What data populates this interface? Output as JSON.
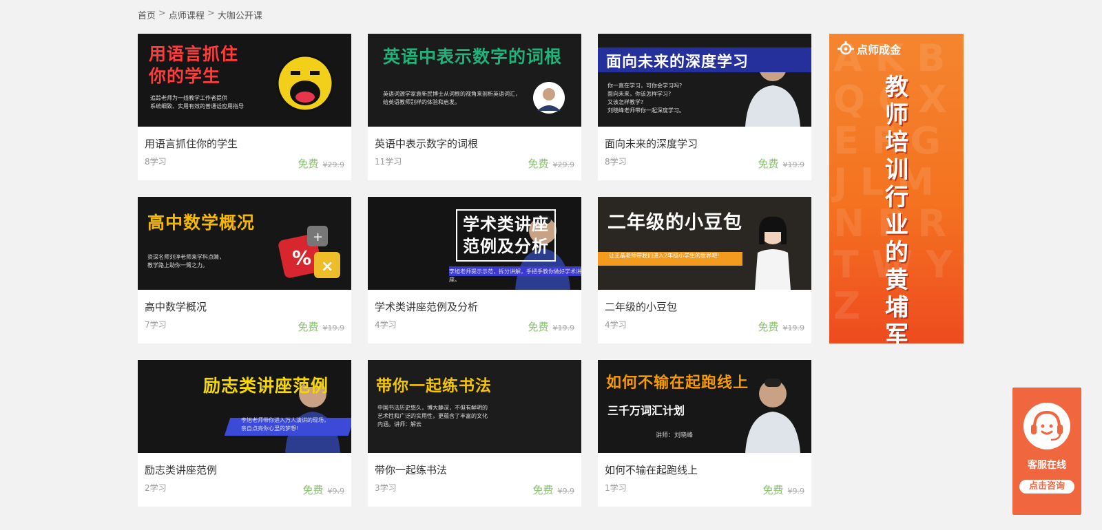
{
  "breadcrumb": {
    "home": "首页",
    "sep1": ">",
    "courses": "点师课程",
    "sep2": ">",
    "current": "大咖公开课"
  },
  "courses": [
    {
      "title": "用语言抓住你的学生",
      "learners": "8学习",
      "price_label": "免费",
      "original_price": "¥29.9",
      "thumb": {
        "headline": "用语言抓住\n你的学生",
        "sub": "追踪老师为一线教学工作者提供\n系统细致、实用有效的普通话应用指导",
        "headline_color": "#ff3b3b",
        "bg": "#151515"
      }
    },
    {
      "title": "英语中表示数字的词根",
      "learners": "11学习",
      "price_label": "免费",
      "original_price": "¥29.9",
      "thumb": {
        "headline": "英语中表示数字的词根",
        "sub": "英语词源学家袁新民博士从词根的视角来剖析英语词汇，\n给英语教师别样的体验和启发。",
        "headline_color": "#1fb37a",
        "bg": "#1b1b1b"
      }
    },
    {
      "title": "面向未来的深度学习",
      "learners": "8学习",
      "price_label": "免费",
      "original_price": "¥19.9",
      "thumb": {
        "headline": "面向未来的深度学习",
        "sub": "你一直在学习，可你会学习吗?\n面向未来，你该怎样学习?\n又该怎样教学?\n刘晓峰老师带你一起深度学习。",
        "headline_color": "#ffffff",
        "bg": "#1a1a1a"
      }
    },
    {
      "title": "高中数学概况",
      "learners": "7学习",
      "price_label": "免费",
      "original_price": "¥19.9",
      "thumb": {
        "headline": "高中数学概况",
        "sub": "资深名师刘淳老师来学科点睛，\n教学路上助你一臂之力。",
        "headline_color": "#f5b800",
        "bg": "#161616"
      }
    },
    {
      "title": "学术类讲座范例及分析",
      "learners": "4学习",
      "price_label": "免费",
      "original_price": "¥19.9",
      "thumb": {
        "headline": "学术类讲座\n范例及分析",
        "sub": "李旭老师提示示范，拆分讲解，手把手教你做好学术讲座。",
        "headline_color": "#ffffff",
        "bg": "#141414"
      }
    },
    {
      "title": "二年级的小豆包",
      "learners": "4学习",
      "price_label": "免费",
      "original_price": "¥19.9",
      "thumb": {
        "headline": "二年级的小豆包",
        "sub": "让王晶老师带我们进入2年级小学生的世界吧!",
        "headline_color": "#ffffff",
        "bg": "#2a2622"
      }
    },
    {
      "title": "励志类讲座范例",
      "learners": "2学习",
      "price_label": "免费",
      "original_price": "¥9.9",
      "thumb": {
        "headline": "励志类讲座范例",
        "sub": "李旭老师带你进入万人演讲的现场，\n亲自点亮你心里的梦想!",
        "headline_color": "#f5d800",
        "bg": "#151515"
      }
    },
    {
      "title": "带你一起练书法",
      "learners": "3学习",
      "price_label": "免费",
      "original_price": "¥9.9",
      "thumb": {
        "headline": "带你一起练书法",
        "sub": "中国书法历史悠久，博大静深，不但有鲜明的\n艺术性和广泛的实用性，更蕴含了丰富的文化\n内涵。讲师：解云",
        "headline_color": "#f5c400",
        "bg": "#1c1c1c"
      }
    },
    {
      "title": "如何不输在起跑线上",
      "learners": "1学习",
      "price_label": "免费",
      "original_price": "¥9.9",
      "thumb": {
        "headline": "如何不输在起跑线上",
        "sub": "三千万词汇计划",
        "extra": "讲师：刘晓峰",
        "headline_color": "#f59a00",
        "bg": "#171717"
      }
    }
  ],
  "ad": {
    "brand": "点师成金",
    "vertical_text": "教师培训行业的黄埔军校",
    "bg_letters": "A K B Q C X E F G J L M N P R T W Y Z"
  },
  "service": {
    "label": "客服在线",
    "button": "点击咨询",
    "color": "#f0663f"
  }
}
